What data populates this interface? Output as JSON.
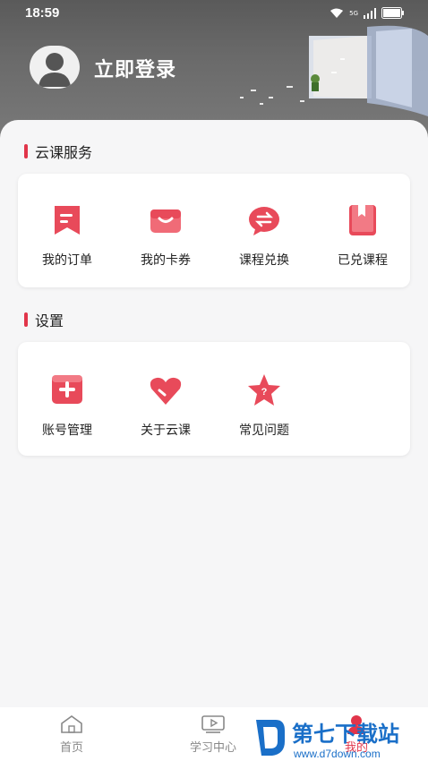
{
  "status": {
    "time": "18:59",
    "signal": "5G"
  },
  "header": {
    "login_label": "立即登录"
  },
  "services": {
    "title": "云课服务",
    "items": [
      {
        "label": "我的订单",
        "icon": "bookmark-list-icon"
      },
      {
        "label": "我的卡券",
        "icon": "card-wallet-icon"
      },
      {
        "label": "课程兑换",
        "icon": "exchange-chat-icon"
      },
      {
        "label": "已兑课程",
        "icon": "book-icon"
      }
    ]
  },
  "settings": {
    "title": "设置",
    "items": [
      {
        "label": "账号管理",
        "icon": "plus-box-icon"
      },
      {
        "label": "关于云课",
        "icon": "heart-icon"
      },
      {
        "label": "常见问题",
        "icon": "star-question-icon"
      }
    ]
  },
  "tabbar": {
    "tabs": [
      {
        "label": "首页",
        "icon": "home-icon"
      },
      {
        "label": "学习中心",
        "icon": "play-screen-icon"
      },
      {
        "label": "我的",
        "icon": "profile-icon"
      }
    ]
  },
  "watermark": {
    "brand": "第七下载站",
    "url": "www.d7down.com"
  },
  "colors": {
    "accent": "#e1354a",
    "header_bg": "#666666",
    "card_bg": "#ffffff"
  }
}
